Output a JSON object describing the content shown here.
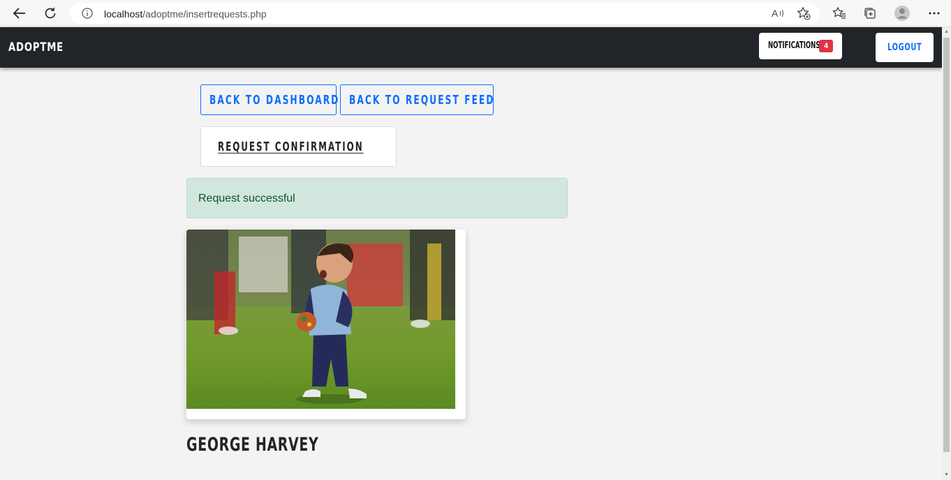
{
  "browser": {
    "url_host": "localhost",
    "url_path": "/adoptme/insertrequests.php",
    "icons": [
      "back-icon",
      "refresh-icon",
      "info-icon",
      "read-aloud-icon",
      "add-favorite-icon",
      "favorites-icon",
      "collections-icon",
      "profile-icon",
      "more-icon"
    ]
  },
  "navbar": {
    "brand": "ADOPTME",
    "notifications_label": "NOTIFICATIONS",
    "notifications_count": "4",
    "logout_label": "LOGOUT",
    "colors": {
      "background": "#212529",
      "badge": "#dc3545",
      "accent": "#0d6efd"
    }
  },
  "main": {
    "back_dashboard_label": "BACK TO DASHBOARD",
    "back_feed_label": "BACK TO REQUEST FEED",
    "confirmation_title": "REQUEST CONFIRMATION",
    "alert_text": "Request successful",
    "alert_color": "#d1e7dd",
    "child_name": "GEORGE HARVEY"
  }
}
